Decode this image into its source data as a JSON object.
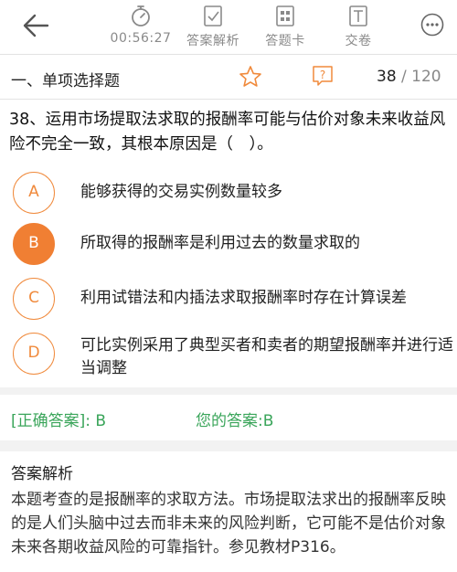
{
  "toolbar": {
    "timer": "00:56:27",
    "analysis_label": "答案解析",
    "card_label": "答题卡",
    "submit_label": "交卷"
  },
  "section": {
    "title": "一、单项选择题",
    "current": "38",
    "total": " / 120"
  },
  "question": {
    "text": "38、运用市场提取法求取的报酬率可能与估价对象未来收益风险不完全一致，其根本原因是（　）。"
  },
  "options": [
    {
      "letter": "A",
      "text": "能够获得的交易实例数量较多",
      "selected": false
    },
    {
      "letter": "B",
      "text": "所取得的报酬率是利用过去的数量求取的",
      "selected": true
    },
    {
      "letter": "C",
      "text": "利用试错法和内插法求取报酬率时存在计算误差",
      "selected": false
    },
    {
      "letter": "D",
      "text": "可比实例采用了典型买者和卖者的期望报酬率并进行适当调整",
      "selected": false
    }
  ],
  "result": {
    "correct_answer": "[正确答案]: B",
    "your_answer": "您的答案:B"
  },
  "explanation": {
    "title": "答案解析",
    "text": "本题考查的是报酬率的求取方法。市场提取法求出的报酬率反映的是人们头脑中过去而非未来的风险判断，它可能不是估价对象未来各期收益风险的可靠指针。参见教材P316。"
  },
  "colors": {
    "accent": "#f07f33",
    "correct": "#3aa55a",
    "icon_gray": "#8a8a8a"
  },
  "icons": [
    "back-arrow-icon",
    "stopwatch-icon",
    "answer-analysis-icon",
    "answer-card-icon",
    "submit-icon",
    "more-icon",
    "star-icon",
    "question-mark-icon"
  ]
}
